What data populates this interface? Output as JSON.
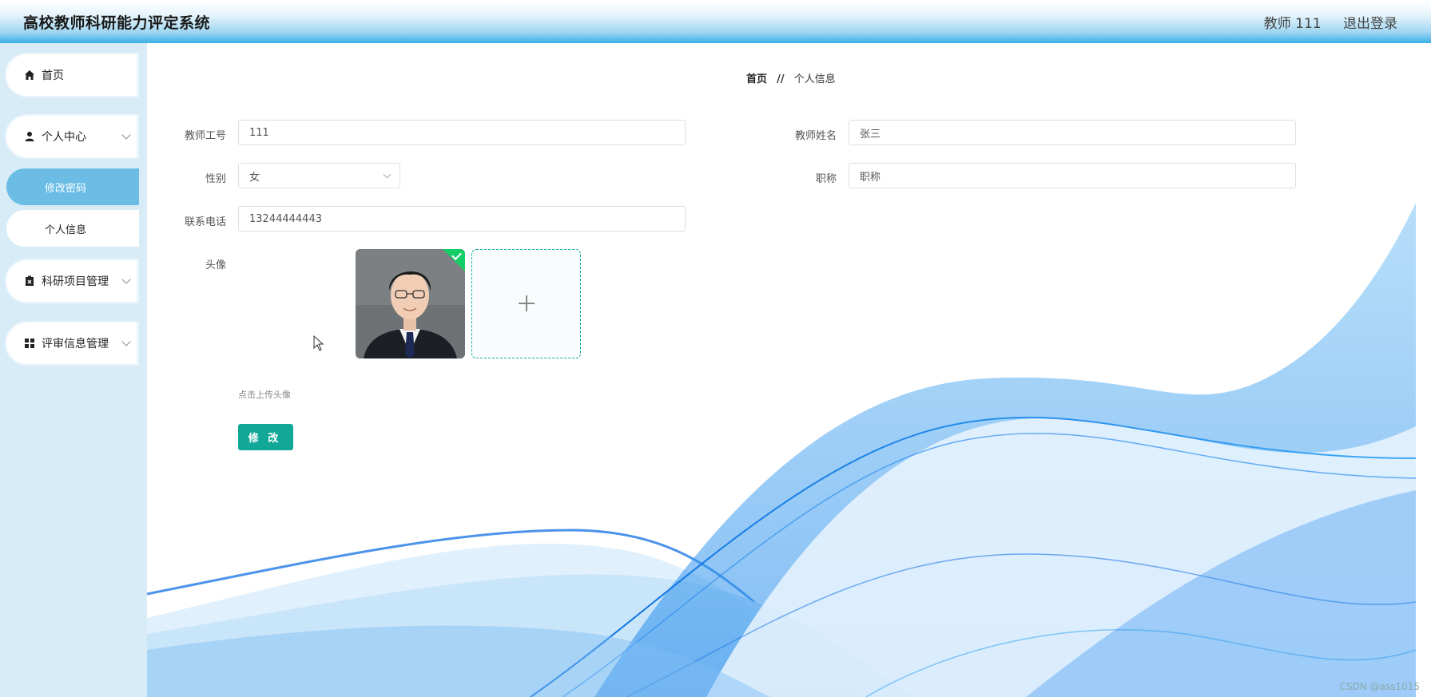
{
  "header": {
    "title": "高校教师科研能力评定系统",
    "user": "教师 111",
    "logout": "退出登录"
  },
  "sidebar": {
    "items": [
      {
        "label": "首页",
        "icon": "home-icon"
      },
      {
        "label": "个人中心",
        "icon": "user-icon",
        "expanded": true,
        "children": [
          {
            "label": "修改密码",
            "active": true
          },
          {
            "label": "个人信息"
          }
        ]
      },
      {
        "label": "科研项目管理",
        "icon": "clipboard-icon"
      },
      {
        "label": "评审信息管理",
        "icon": "grid-icon"
      }
    ]
  },
  "breadcrumb": {
    "home": "首页",
    "separator": "//",
    "current": "个人信息"
  },
  "form": {
    "teacher_id": {
      "label": "教师工号",
      "value": "111"
    },
    "teacher_name": {
      "label": "教师姓名",
      "value": "张三"
    },
    "gender": {
      "label": "性别",
      "value": "女"
    },
    "title": {
      "label": "职称",
      "value": "职称"
    },
    "phone": {
      "label": "联系电话",
      "value": "13244444443"
    },
    "avatar": {
      "label": "头像",
      "tip": "点击上传头像"
    },
    "submit": "修 改"
  },
  "colors": {
    "accent": "#12a897",
    "sidebar_bg": "#d7ecf7",
    "active_menu": "#6bbde6",
    "header_gradient_end": "#39aee6"
  },
  "watermark": "CSDN @ass1015"
}
